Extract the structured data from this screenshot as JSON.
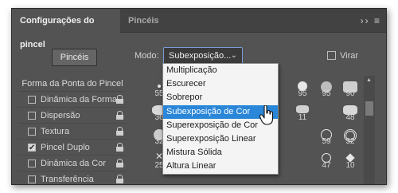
{
  "tabs": [
    {
      "label": "Configurações do pincel"
    },
    {
      "label": "Pincéis"
    }
  ],
  "panel_menu_icons": "›› ≡",
  "pinceis_button": "Pincéis",
  "mode": {
    "label": "Modo:",
    "selected": "Subexposição..."
  },
  "flip": {
    "label": "Virar",
    "checked": false
  },
  "sidebar": {
    "header": "Forma da Ponta do Pincel",
    "items": [
      {
        "label": "Dinâmica da Forma",
        "checked": false
      },
      {
        "label": "Dispersão",
        "checked": false
      },
      {
        "label": "Textura",
        "checked": false
      },
      {
        "label": "Pincel Duplo",
        "checked": true
      },
      {
        "label": "Dinâmica da Cor",
        "checked": false
      },
      {
        "label": "Transferência",
        "checked": false
      }
    ]
  },
  "dropdown": {
    "items": [
      "Multiplicação",
      "Escurecer",
      "Sobrepor",
      "Subexposição de Cor",
      "Superexposição de Cor",
      "Superexposição Linear",
      "Mistura Sólida",
      "Altura Linear"
    ],
    "selected_index": 3
  },
  "brush_presets": {
    "sizes": [
      "55",
      "95",
      "95",
      "90",
      "36",
      "11",
      "48",
      "32",
      "59",
      "32",
      "25",
      "47",
      "10"
    ]
  },
  "colors": {
    "panel": "#535353",
    "tab_bar": "#424242",
    "highlight": "#2a86d8",
    "menu_bg": "#f4f4f4"
  }
}
